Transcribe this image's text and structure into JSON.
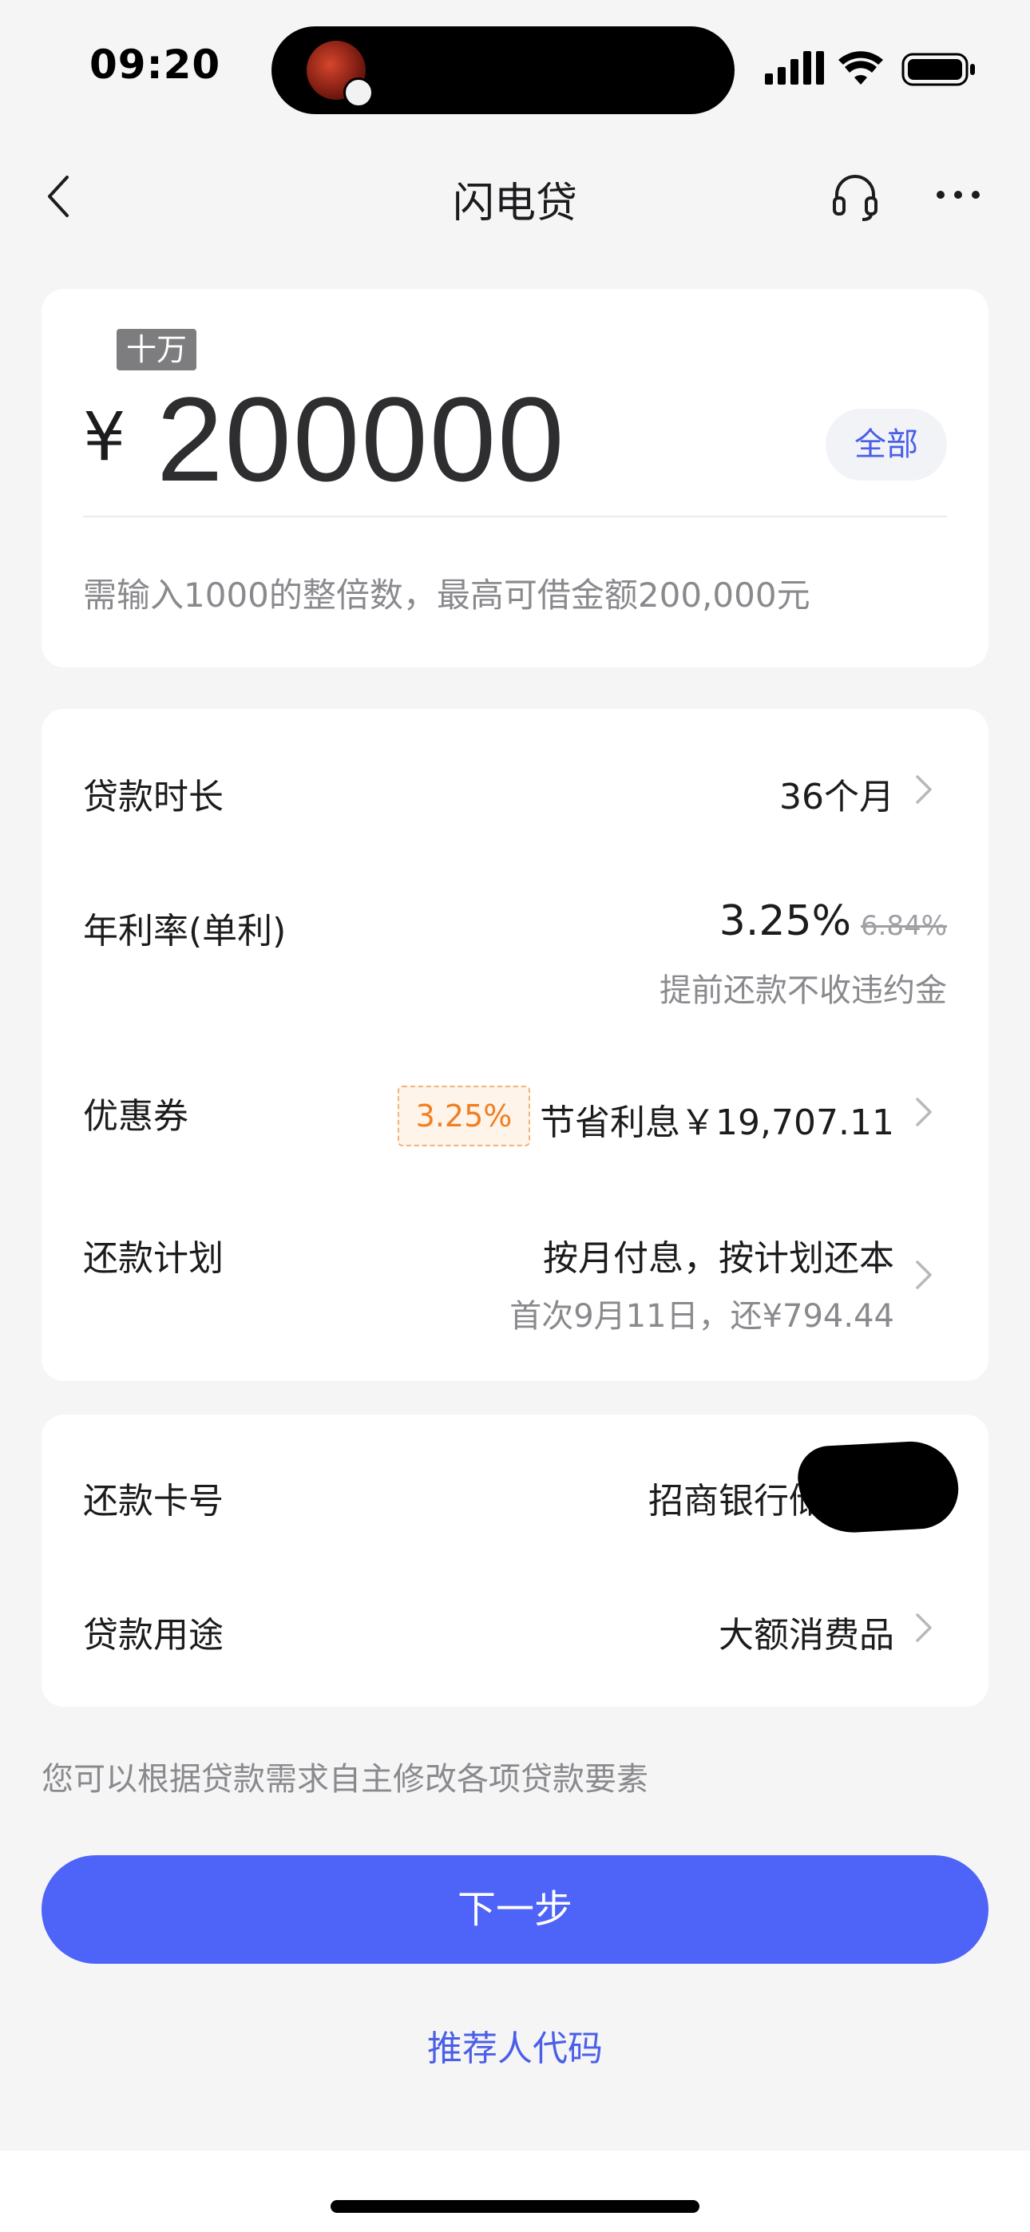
{
  "status_bar": {
    "time": "09:20",
    "icons": [
      "signal-icon",
      "wifi-icon",
      "battery-icon"
    ]
  },
  "nav": {
    "title": "闪电贷",
    "icons": [
      "back-icon",
      "headset-icon",
      "more-icon"
    ]
  },
  "amount_card": {
    "unit_badge": "十万",
    "currency": "¥",
    "amount": "200000",
    "all_button": "全部",
    "hint": "需输入1000的整倍数，最高可借金额200,000元"
  },
  "loan_card": {
    "term": {
      "label": "贷款时长",
      "value": "36个月"
    },
    "rate": {
      "label": "年利率(单利)",
      "value": "3.25%",
      "original": "6.84%",
      "note": "提前还款不收违约金"
    },
    "coupon": {
      "label": "优惠券",
      "tag": "3.25%",
      "value": "节省利息￥19,707.11"
    },
    "plan": {
      "label": "还款计划",
      "value": "按月付息，按计划还本",
      "note": "首次9月11日，还¥794.44"
    }
  },
  "account_card": {
    "card": {
      "label": "还款卡号",
      "value": "招商银行储蓄卡"
    },
    "purpose": {
      "label": "贷款用途",
      "value": "大额消费品"
    }
  },
  "footer": {
    "hint": "您可以根据贷款需求自主修改各项贷款要素",
    "next_button": "下一步",
    "referral_link": "推荐人代码"
  },
  "colors": {
    "accent": "#4e63f7",
    "link": "#4a5fe8",
    "coupon": "#f07f22",
    "background": "#f5f5f6"
  }
}
